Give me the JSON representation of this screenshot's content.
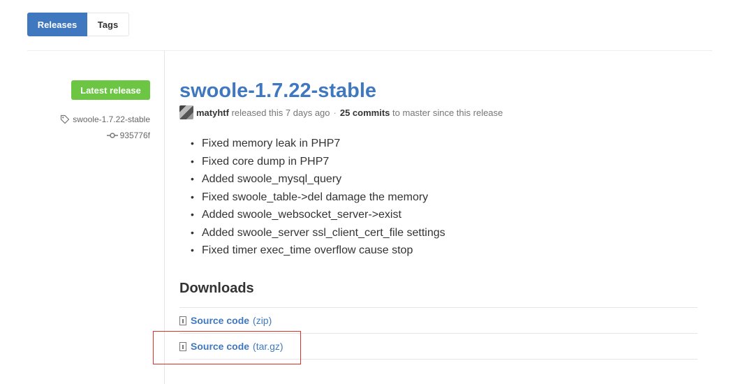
{
  "tabs": {
    "releases_label": "Releases",
    "tags_label": "Tags",
    "active": "Releases"
  },
  "release": {
    "badge": "Latest release",
    "tag": "swoole-1.7.22-stable",
    "commit": "935776f",
    "title": "swoole-1.7.22-stable",
    "author": "matyhtf",
    "released_text": "released this 7 days ago",
    "separator": "·",
    "commits_count": "25 commits",
    "commits_suffix": "to master since this release",
    "notes": [
      "Fixed memory leak in PHP7",
      "Fixed core dump in PHP7",
      "Added swoole_mysql_query",
      "Fixed swoole_table->del damage the memory",
      "Added swoole_websocket_server->exist",
      "Added swoole_server ssl_client_cert_file settings",
      "Fixed timer exec_time overflow cause stop"
    ],
    "bullet": "•"
  },
  "downloads": {
    "heading": "Downloads",
    "items": [
      {
        "name": "Source code",
        "type": "(zip)"
      },
      {
        "name": "Source code",
        "type": "(tar.gz)"
      }
    ]
  },
  "colors": {
    "link": "#4078c0",
    "badge_green": "#6cc644",
    "highlight": "#e0302b"
  },
  "icons": {
    "tag": "tag-icon",
    "commit": "git-commit-icon",
    "file": "file-zip-icon"
  }
}
